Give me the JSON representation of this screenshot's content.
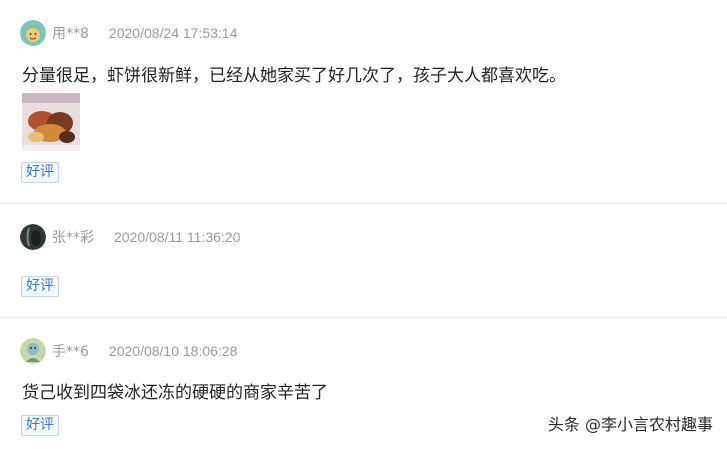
{
  "reviews": [
    {
      "user": "用**8",
      "date": "2020/08/24 17:53:14",
      "text": "分量很足，虾饼很新鲜，已经从她家买了好几次了，孩子大人都喜欢吃。",
      "has_photo": true,
      "tag": "好评",
      "avatar_icon": "teal-face-avatar"
    },
    {
      "user": "张**彩",
      "date": "2020/08/11 11:36:20",
      "text": "",
      "has_photo": false,
      "tag": "好评",
      "avatar_icon": "dark-photo-avatar"
    },
    {
      "user": "手**6",
      "date": "2020/08/10 18:06:28",
      "text": "货己收到四袋冰还冻的硬硬的商家辛苦了",
      "has_photo": false,
      "tag": "好评",
      "avatar_icon": "cartoon-avatar"
    }
  ],
  "watermark": "头条 @李小言农村趣事",
  "colors": {
    "tag_text": "#3f79c2",
    "tag_border": "#c2d6ee",
    "meta_text": "#9a9a9a",
    "body_text": "#222222"
  }
}
